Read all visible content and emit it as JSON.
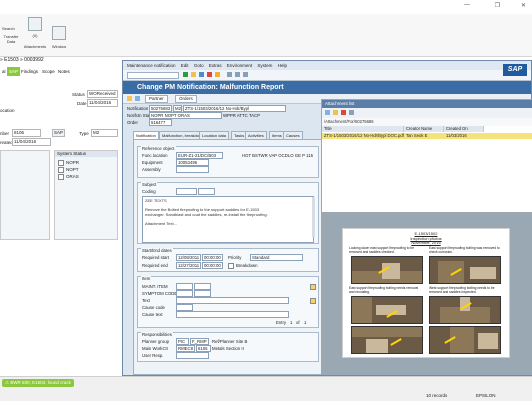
{
  "host": {
    "window_buttons": [
      "—",
      "❐",
      "✕"
    ],
    "ribbon": [
      {
        "label": "Search",
        "sub": ""
      },
      {
        "label": "Transfer Data",
        "sub": ""
      },
      {
        "label": "",
        "sub": "(0)"
      },
      {
        "label": "Attachments",
        "sub": ""
      },
      {
        "label": "Window",
        "sub": ""
      }
    ],
    "path_text": "» E1503 » 0003992",
    "tabs": [
      "al",
      "SAP",
      "Findings",
      "Scope",
      "Notes"
    ],
    "status_label": "Status",
    "status_value": "WOReceived",
    "date_label": "Date",
    "date_value": "11/04/2016",
    "location_label": "ocation",
    "number_label": "nber",
    "number_value": "8106",
    "sap_chip": "SAP",
    "type_label": "Type",
    "type_value": "M2",
    "created_label": "reated",
    "created_value": "11/04/2016",
    "system_status_header": "System Status",
    "system_status": [
      "NOPR",
      "NOPT",
      "ORAS"
    ],
    "warning_text": "BWR 500, E1503, found crack",
    "records": "10 records",
    "epsilon": "EPSILON"
  },
  "sap": {
    "menu": [
      "Maintenance notification",
      "Edit",
      "Goto",
      "Extras",
      "Environment",
      "System",
      "Help"
    ],
    "brand": "SAP",
    "title": "Change PM Notification: Malfunction Report",
    "app_buttons": [
      "Partner",
      "Orders"
    ],
    "header": {
      "notification_label": "Notification",
      "notification_value": "50275683",
      "notification_type": "M2",
      "notification_desc": "ZTS-1/1503/2016/12 No-Hdr/Bypl",
      "status_label": "Notifctn Status",
      "status_value": "NOPR NOPT ORAS",
      "status_extra": "WPPR  ATTC  TACP",
      "order_label": "Order",
      "order_value": "516477"
    },
    "tabs": [
      "Notification",
      "Malfunction, breakdown",
      "Location data",
      "Tasks",
      "Activities",
      "Items",
      "Causes"
    ],
    "reference_object": {
      "title": "Reference object",
      "func_loc_label": "Func.location",
      "func_loc_value": "EUR-Z1-21/DC/B03",
      "func_loc_desc": "HGT BSTWR VAP OCDLO GE P 115",
      "equipment_label": "Equipment",
      "equipment_value": "10053496",
      "assembly_label": "Assembly"
    },
    "subject": {
      "title": "Subject",
      "coding_label": "Coding",
      "lines": [
        "ZEE TEXTS",
        "",
        "Remove the Bolted firepoofing to the support saddles for E-1503",
        "exchanger. Sandblast and coat the saddles, re-install the fireproofing.",
        "",
        "Attachment Text..."
      ]
    },
    "execution": {
      "title": "Start/End dates",
      "req_start_label": "Required start",
      "req_start_date": "12/08/2011",
      "req_start_time": "00:00:00",
      "priority_label": "Priority",
      "priority_value": "Standard",
      "req_end_label": "Required end",
      "req_end_date": "12/27/2011",
      "req_end_time": "00:00:00",
      "breakdown_label": "Breakdown"
    },
    "item": {
      "title": "Item",
      "rows": [
        "MAINT. ITEM",
        "SYMPTOM CODE",
        "Text",
        "Cause code",
        "Cause text"
      ],
      "entry_label": "Entry",
      "entry_value": "1",
      "entry_of": "of",
      "entry_total": "1"
    },
    "responsibilities": {
      "title": "Responsibilities",
      "planner_label": "Planner group",
      "planner_value": "PIC",
      "planner_code": "F_RMP",
      "planner_desc": "Ref/Planner Site B",
      "workctr_label": "Main WorkCtr",
      "workctr_value": "RMEC8",
      "workctr_code": "6106",
      "workctr_desc": "Metals Section II",
      "user_label": "User Resp."
    },
    "attachments": {
      "title": "Attachment list",
      "path": "/Attachment/For/50275686",
      "columns": [
        "Title",
        "Creator Name",
        "Created On"
      ],
      "row": {
        "title": "ZTS-1/1503/2016/12 No-Hdr/Bypl DOC.pdf",
        "creator": "Tan Seok E",
        "created": "11/03/2016"
      },
      "doc_heading_1": "E-1503/1502",
      "doc_heading_2": "Inspection photos",
      "doc_heading_3": "November, 2016",
      "captions": [
        "Looking down east support fireproofing to be removed and saddles checked.",
        "East support fireproofing bolting was removed to check corrosion.",
        "East support fireproofing bolting needs removal and recoating.",
        "West support fireproofing bolting needs to be removed and saddles inspected.",
        "",
        ""
      ]
    }
  }
}
